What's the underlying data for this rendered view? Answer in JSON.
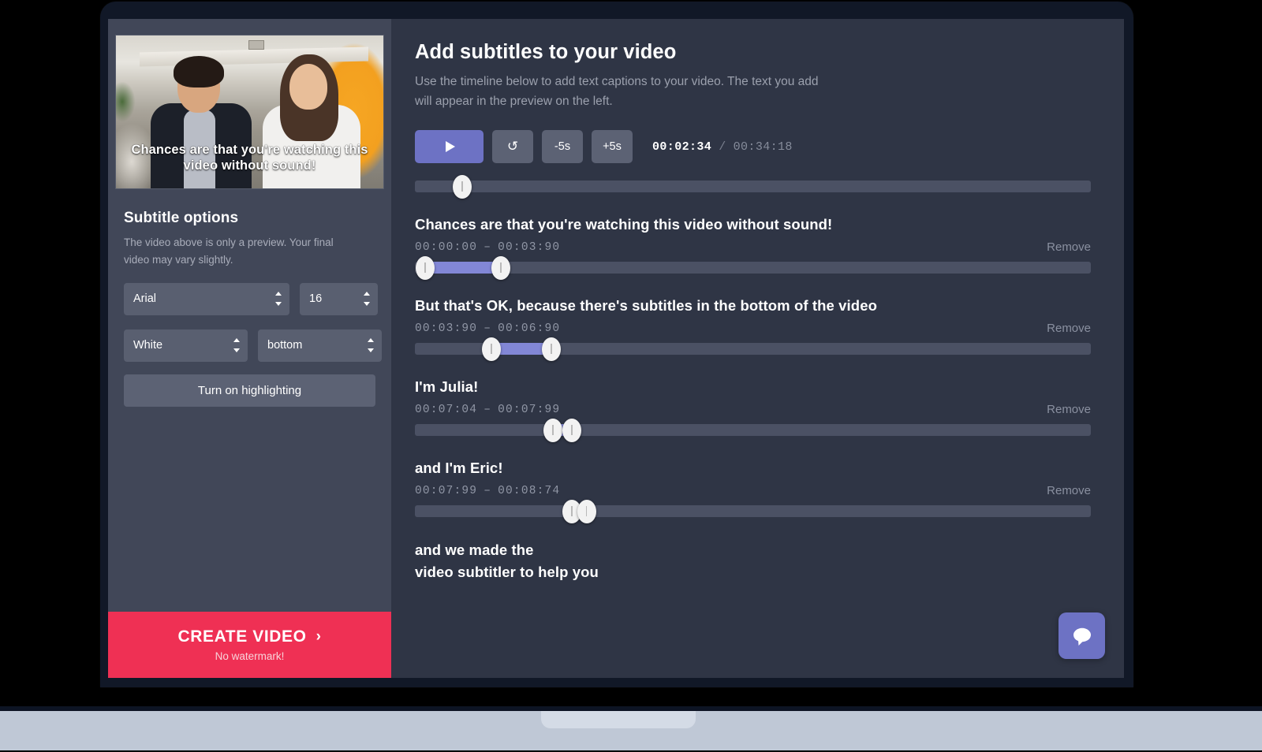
{
  "sidebar": {
    "video_caption": "Chances are that you're watching this video without sound!",
    "options_title": "Subtitle options",
    "options_subtitle": "The video above is only a preview. Your final video may vary slightly.",
    "font_family_value": "Arial",
    "font_size_value": "16",
    "font_color_value": "White",
    "position_value": "bottom",
    "highlight_button_label": "Turn on highlighting",
    "create_video_label": "CREATE VIDEO",
    "create_video_arrow": "›",
    "create_video_subtext": "No watermark!",
    "create_video_color": "#ef3054"
  },
  "main": {
    "title": "Add subtitles to your video",
    "subtitle": "Use the timeline below to add text captions to your video. The text you add will appear in the preview on the left.",
    "controls": {
      "play_icon": "play-icon",
      "loop_label": "↺",
      "back_label": "-5s",
      "forward_label": "+5s",
      "current_time": "00:02:34",
      "separator": "/",
      "total_time": "00:34:18",
      "accent_color": "#6d72c4"
    },
    "seek_percent": 7,
    "subtitles": [
      {
        "text": "Chances are that you're watching this video without sound!",
        "start": "00:00:00",
        "dash": "–",
        "end": "00:03:90",
        "remove_label": "Remove",
        "range_start_percent": 1.5,
        "range_end_percent": 12.7
      },
      {
        "text": "But that's OK, because there's subtitles in the bottom of the video",
        "start": "00:03:90",
        "dash": "–",
        "end": "00:06:90",
        "remove_label": "Remove",
        "range_start_percent": 11.3,
        "range_end_percent": 20.2
      },
      {
        "text": "I'm Julia!",
        "start": "00:07:04",
        "dash": "–",
        "end": "00:07:99",
        "remove_label": "Remove",
        "range_start_percent": 20.4,
        "range_end_percent": 23.2
      },
      {
        "text": "and I'm Eric!",
        "start": "00:07:99",
        "dash": "–",
        "end": "00:08:74",
        "remove_label": "Remove",
        "range_start_percent": 23.2,
        "range_end_percent": 25.4
      }
    ],
    "tail_text_line1": "and we made the",
    "tail_text_line2": "video subtitler to help you",
    "chat_icon": "chat-bubble-icon"
  }
}
